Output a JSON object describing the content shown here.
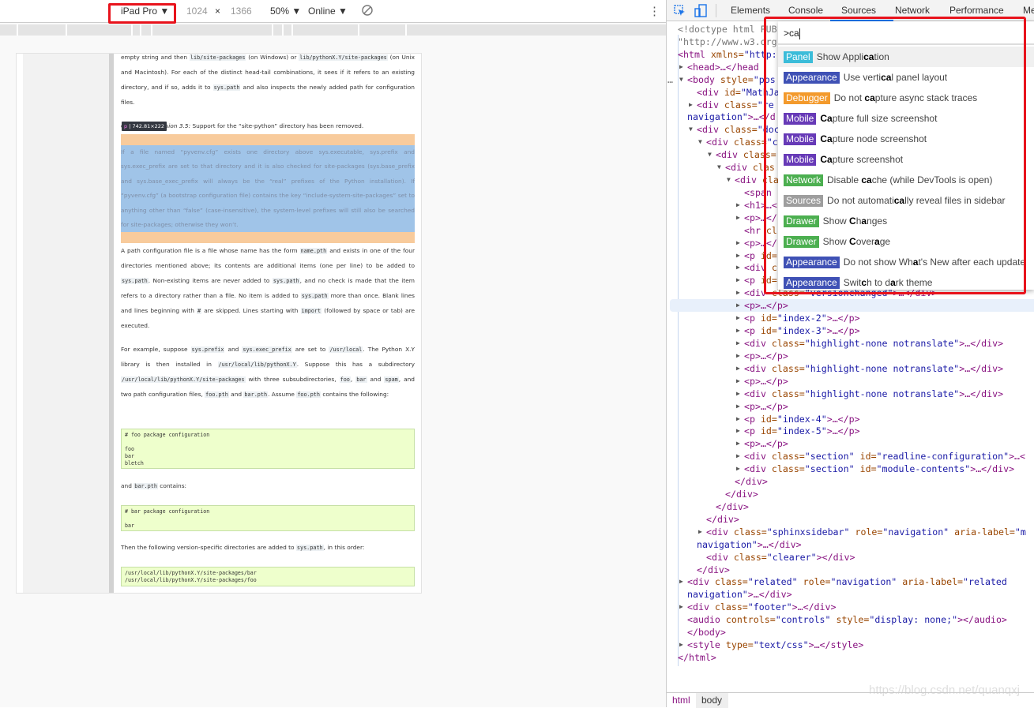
{
  "toolbar": {
    "device": "iPad Pro ▼",
    "width": "1024",
    "times": "×",
    "height": "1366",
    "zoom": "50% ▼",
    "network": "Online ▼",
    "more": "⋮"
  },
  "document": {
    "p1": [
      [
        "empty string and then ",
        0
      ],
      [
        "lib/site-packages",
        1
      ],
      [
        " (on Windows) or ",
        0
      ],
      [
        "lib/pythonX.Y/site-packages",
        1
      ],
      [
        " (on Unix and Macintosh). For each of the distinct head-tail combinations, it sees if it refers to an existing directory, and if so, adds it to ",
        0
      ],
      [
        "sys.path",
        1
      ],
      [
        " and also inspects the newly added path for configuration files.",
        0
      ]
    ],
    "version_note_label": "Changed in version 3.5:",
    "version_note": " Support for the “site-python” directory has been removed.",
    "tooltip_tag": "p",
    "tooltip_size": "742.81×222",
    "highlighted": "If a file named “pyvenv.cfg” exists one directory above sys.executable, sys.prefix and sys.exec_prefix are set to that directory and it is also checked for site-packages (sys.base_prefix and sys.base_exec_prefix will always be the “real” prefixes of the Python installation). If “pyvenv.cfg” (a bootstrap configuration file) contains the key “include-system-site-packages” set to anything other than “false” (case-insensitive), the system-level prefixes will still also be searched for site-packages; otherwise they won’t.",
    "p3": [
      [
        "A path configuration file is a file whose name has the form ",
        0
      ],
      [
        "name.pth",
        1
      ],
      [
        " and exists in one of the four directories mentioned above; its contents are additional items (one per line) to be added to ",
        0
      ],
      [
        "sys.path",
        1
      ],
      [
        ". Non-existing items are never added to ",
        0
      ],
      [
        "sys.path",
        1
      ],
      [
        ", and no check is made that the item refers to a directory rather than a file. No item is added to ",
        0
      ],
      [
        "sys.path",
        1
      ],
      [
        " more than once. Blank lines and lines beginning with ",
        0
      ],
      [
        "#",
        1
      ],
      [
        " are skipped. Lines starting with ",
        0
      ],
      [
        "import",
        1
      ],
      [
        " (followed by space or tab) are executed.",
        0
      ]
    ],
    "p4": [
      [
        "For example, suppose ",
        0
      ],
      [
        "sys.prefix",
        1
      ],
      [
        " and ",
        0
      ],
      [
        "sys.exec_prefix",
        1
      ],
      [
        " are set to ",
        0
      ],
      [
        "/usr/local",
        1
      ],
      [
        ". The Python X.Y library is then installed in ",
        0
      ],
      [
        "/usr/local/lib/pythonX.Y",
        1
      ],
      [
        ". Suppose this has a subdirectory ",
        0
      ],
      [
        "/usr/local/lib/pythonX.Y/site-packages",
        1
      ],
      [
        " with three subsubdirectories, ",
        0
      ],
      [
        "foo",
        1
      ],
      [
        ", ",
        0
      ],
      [
        "bar",
        1
      ],
      [
        " and ",
        0
      ],
      [
        "spam",
        1
      ],
      [
        ", and two path configuration files, ",
        0
      ],
      [
        "foo.pth",
        1
      ],
      [
        " and ",
        0
      ],
      [
        "bar.pth",
        1
      ],
      [
        ". Assume ",
        0
      ],
      [
        "foo.pth",
        1
      ],
      [
        " contains the following:",
        0
      ]
    ],
    "code1": "# foo package configuration\n\nfoo\nbar\nbletch",
    "p5": [
      [
        "and ",
        0
      ],
      [
        "bar.pth",
        1
      ],
      [
        " contains:",
        0
      ]
    ],
    "code2": "# bar package configuration\n\nbar",
    "p6": [
      [
        "Then the following version-specific directories are added to ",
        0
      ],
      [
        "sys.path",
        1
      ],
      [
        ", in this order:",
        0
      ]
    ],
    "code3": "/usr/local/lib/pythonX.Y/site-packages/bar\n/usr/local/lib/pythonX.Y/site-packages/foo"
  },
  "devtools": {
    "tabs": [
      "Elements",
      "Console",
      "Sources",
      "Network",
      "Performance",
      "Me"
    ],
    "active_tab": "Elements",
    "tree": [
      [
        0,
        "",
        [
          [
            "p",
            "<!doctype html PUB"
          ]
        ]
      ],
      [
        0,
        "",
        [
          [
            "p",
            "\"http://www.w3.org"
          ]
        ]
      ],
      [
        0,
        "",
        [
          [
            "t",
            "<html"
          ],
          [
            "a",
            " xmlns="
          ],
          [
            "v",
            "\"http:"
          ]
        ]
      ],
      [
        1,
        "▶",
        [
          [
            "t",
            "<head>…</head"
          ]
        ]
      ],
      [
        1,
        "▼",
        [
          [
            "t",
            "<body"
          ],
          [
            "a",
            " style="
          ],
          [
            "v",
            "\"pos"
          ]
        ]
      ],
      [
        2,
        "",
        [
          [
            "t",
            "<div"
          ],
          [
            "a",
            " id="
          ],
          [
            "v",
            "\"MathJa"
          ]
        ]
      ],
      [
        2,
        "▶",
        [
          [
            "t",
            "<div"
          ],
          [
            "a",
            " class="
          ],
          [
            "v",
            "\"re"
          ]
        ]
      ],
      [
        1,
        "",
        [
          [
            "v",
            "navigation\""
          ],
          [
            "t",
            ">…</d"
          ]
        ]
      ],
      [
        2,
        "▼",
        [
          [
            "t",
            "<div"
          ],
          [
            "a",
            " class="
          ],
          [
            "v",
            "\"doc"
          ]
        ]
      ],
      [
        3,
        "▼",
        [
          [
            "t",
            "<div"
          ],
          [
            "a",
            " class="
          ],
          [
            "v",
            "\"c"
          ]
        ]
      ],
      [
        4,
        "▼",
        [
          [
            "t",
            "<div"
          ],
          [
            "a",
            " class="
          ]
        ]
      ],
      [
        5,
        "▼",
        [
          [
            "t",
            "<div"
          ],
          [
            "a",
            " clas"
          ]
        ]
      ],
      [
        6,
        "▼",
        [
          [
            "t",
            "<div"
          ],
          [
            "a",
            " cla"
          ]
        ]
      ],
      [
        7,
        "",
        [
          [
            "t",
            "<span"
          ]
        ]
      ],
      [
        7,
        "▶",
        [
          [
            "t",
            "<h1>…<"
          ]
        ]
      ],
      [
        7,
        "▶",
        [
          [
            "t",
            "<p>…</"
          ]
        ]
      ],
      [
        7,
        "",
        [
          [
            "t",
            "<hr"
          ],
          [
            "a",
            " cl"
          ]
        ]
      ],
      [
        7,
        "▶",
        [
          [
            "t",
            "<p>…</"
          ]
        ]
      ],
      [
        7,
        "▶",
        [
          [
            "t",
            "<p"
          ],
          [
            "a",
            " id="
          ]
        ]
      ],
      [
        7,
        "▶",
        [
          [
            "t",
            "<div"
          ],
          [
            "a",
            " c"
          ]
        ]
      ],
      [
        7,
        "▶",
        [
          [
            "t",
            "<p"
          ],
          [
            "a",
            " id="
          ]
        ]
      ],
      [
        7,
        "▶",
        [
          [
            "t",
            "<div"
          ],
          [
            "a",
            " class="
          ],
          [
            "v",
            "\"versionchanged\""
          ],
          [
            "t",
            ">…</div>"
          ]
        ]
      ],
      [
        7,
        "▶",
        [
          [
            "t",
            "<p>…</p>"
          ]
        ]
      ],
      [
        7,
        "▶",
        [
          [
            "t",
            "<p"
          ],
          [
            "a",
            " id="
          ],
          [
            "v",
            "\"index-2\""
          ],
          [
            "t",
            ">…</p>"
          ]
        ]
      ],
      [
        7,
        "▶",
        [
          [
            "t",
            "<p"
          ],
          [
            "a",
            " id="
          ],
          [
            "v",
            "\"index-3\""
          ],
          [
            "t",
            ">…</p>"
          ]
        ]
      ],
      [
        7,
        "▶",
        [
          [
            "t",
            "<div"
          ],
          [
            "a",
            " class="
          ],
          [
            "v",
            "\"highlight-none notranslate\""
          ],
          [
            "t",
            ">…</div>"
          ]
        ]
      ],
      [
        7,
        "▶",
        [
          [
            "t",
            "<p>…</p>"
          ]
        ]
      ],
      [
        7,
        "▶",
        [
          [
            "t",
            "<div"
          ],
          [
            "a",
            " class="
          ],
          [
            "v",
            "\"highlight-none notranslate\""
          ],
          [
            "t",
            ">…</div>"
          ]
        ]
      ],
      [
        7,
        "▶",
        [
          [
            "t",
            "<p>…</p>"
          ]
        ]
      ],
      [
        7,
        "▶",
        [
          [
            "t",
            "<div"
          ],
          [
            "a",
            " class="
          ],
          [
            "v",
            "\"highlight-none notranslate\""
          ],
          [
            "t",
            ">…</div>"
          ]
        ]
      ],
      [
        7,
        "▶",
        [
          [
            "t",
            "<p>…</p>"
          ]
        ]
      ],
      [
        7,
        "▶",
        [
          [
            "t",
            "<p"
          ],
          [
            "a",
            " id="
          ],
          [
            "v",
            "\"index-4\""
          ],
          [
            "t",
            ">…</p>"
          ]
        ]
      ],
      [
        7,
        "▶",
        [
          [
            "t",
            "<p"
          ],
          [
            "a",
            " id="
          ],
          [
            "v",
            "\"index-5\""
          ],
          [
            "t",
            ">…</p>"
          ]
        ]
      ],
      [
        7,
        "▶",
        [
          [
            "t",
            "<p>…</p>"
          ]
        ]
      ],
      [
        7,
        "▶",
        [
          [
            "t",
            "<div"
          ],
          [
            "a",
            " class="
          ],
          [
            "v",
            "\"section\""
          ],
          [
            "a",
            " id="
          ],
          [
            "v",
            "\"readline-configuration\""
          ],
          [
            "t",
            ">…<"
          ]
        ]
      ],
      [
        7,
        "▶",
        [
          [
            "t",
            "<div"
          ],
          [
            "a",
            " class="
          ],
          [
            "v",
            "\"section\""
          ],
          [
            "a",
            " id="
          ],
          [
            "v",
            "\"module-contents\""
          ],
          [
            "t",
            ">…</div>"
          ]
        ]
      ],
      [
        6,
        "",
        [
          [
            "t",
            "</div>"
          ]
        ]
      ],
      [
        5,
        "",
        [
          [
            "t",
            "</div>"
          ]
        ]
      ],
      [
        4,
        "",
        [
          [
            "t",
            "</div>"
          ]
        ]
      ],
      [
        3,
        "",
        [
          [
            "t",
            "</div>"
          ]
        ]
      ],
      [
        3,
        "▶",
        [
          [
            "t",
            "<div"
          ],
          [
            "a",
            " class="
          ],
          [
            "v",
            "\"sphinxsidebar\""
          ],
          [
            "a",
            " role="
          ],
          [
            "v",
            "\"navigation\""
          ],
          [
            "a",
            " aria-label="
          ],
          [
            "v",
            "\"m"
          ]
        ]
      ],
      [
        2,
        "",
        [
          [
            "v",
            "navigation\""
          ],
          [
            "t",
            ">…</div>"
          ]
        ]
      ],
      [
        3,
        "",
        [
          [
            "t",
            "<div"
          ],
          [
            "a",
            " class="
          ],
          [
            "v",
            "\"clearer\""
          ],
          [
            "t",
            "></div>"
          ]
        ]
      ],
      [
        2,
        "",
        [
          [
            "t",
            "</div>"
          ]
        ]
      ],
      [
        1,
        "▶",
        [
          [
            "t",
            "<div"
          ],
          [
            "a",
            " class="
          ],
          [
            "v",
            "\"related\""
          ],
          [
            "a",
            " role="
          ],
          [
            "v",
            "\"navigation\""
          ],
          [
            "a",
            " aria-label="
          ],
          [
            "v",
            "\"related"
          ]
        ]
      ],
      [
        1,
        "",
        [
          [
            "v",
            "navigation\""
          ],
          [
            "t",
            ">…</div>"
          ]
        ]
      ],
      [
        1,
        "▶",
        [
          [
            "t",
            "<div"
          ],
          [
            "a",
            " class="
          ],
          [
            "v",
            "\"footer\""
          ],
          [
            "t",
            ">…</div>"
          ]
        ]
      ],
      [
        1,
        "",
        [
          [
            "t",
            "<audio"
          ],
          [
            "a",
            " controls="
          ],
          [
            "v",
            "\"controls\""
          ],
          [
            "a",
            " style="
          ],
          [
            "v",
            "\"display: none;\""
          ],
          [
            "t",
            "></audio>"
          ]
        ]
      ],
      [
        1,
        "",
        [
          [
            "t",
            "</body>"
          ]
        ]
      ],
      [
        1,
        "▶",
        [
          [
            "t",
            "<style"
          ],
          [
            "a",
            " type="
          ],
          [
            "v",
            "\"text/css\""
          ],
          [
            "t",
            ">…</style>"
          ]
        ]
      ],
      [
        0,
        "",
        [
          [
            "t",
            "</html>"
          ]
        ]
      ]
    ],
    "body_ellipsis": "…",
    "breadcrumbs": [
      "html",
      "body"
    ]
  },
  "palette": {
    "query": ">ca",
    "items": [
      {
        "badge": "Panel",
        "color": "#3bbcd9",
        "segments": [
          "Show Appli",
          "ca",
          "tion"
        ]
      },
      {
        "badge": "Appearance",
        "color": "#3f51b5",
        "segments": [
          "Use verti",
          "ca",
          "l panel layout"
        ]
      },
      {
        "badge": "Debugger",
        "color": "#f39a2c",
        "segments": [
          "Do not ",
          "ca",
          "pture async stack traces"
        ]
      },
      {
        "badge": "Mobile",
        "color": "#673ab7",
        "segments": [
          "",
          "Ca",
          "pture full size screenshot"
        ]
      },
      {
        "badge": "Mobile",
        "color": "#673ab7",
        "segments": [
          "",
          "Ca",
          "pture node screenshot"
        ]
      },
      {
        "badge": "Mobile",
        "color": "#673ab7",
        "segments": [
          "",
          "Ca",
          "pture screenshot"
        ]
      },
      {
        "badge": "Network",
        "color": "#4caf50",
        "segments": [
          "Disable ",
          "ca",
          "che (while DevTools is open)"
        ]
      },
      {
        "badge": "Sources",
        "color": "#9e9e9e",
        "segments": [
          "Do not automati",
          "ca",
          "lly reveal files in sidebar"
        ]
      },
      {
        "badge": "Drawer",
        "color": "#4caf50",
        "segments": [
          "Show ",
          "C",
          "h",
          "a",
          "nges"
        ]
      },
      {
        "badge": "Drawer",
        "color": "#4caf50",
        "segments": [
          "Show ",
          "C",
          "over",
          "a",
          "ge"
        ]
      },
      {
        "badge": "Appearance",
        "color": "#3f51b5",
        "segments": [
          "Do not show Wh",
          "a",
          "t's New after each update"
        ]
      },
      {
        "badge": "Appearance",
        "color": "#3f51b5",
        "segments": [
          "Swit",
          "c",
          "h to d",
          "a",
          "rk theme"
        ]
      }
    ]
  },
  "watermark": "https://blog.csdn.net/quanqxj",
  "colors": {
    "highlight_box": "#e8131c",
    "code_bg": "#eeffcc",
    "padding_overlay": "#f8cb9c",
    "content_overlay": "#a0c4e8"
  }
}
